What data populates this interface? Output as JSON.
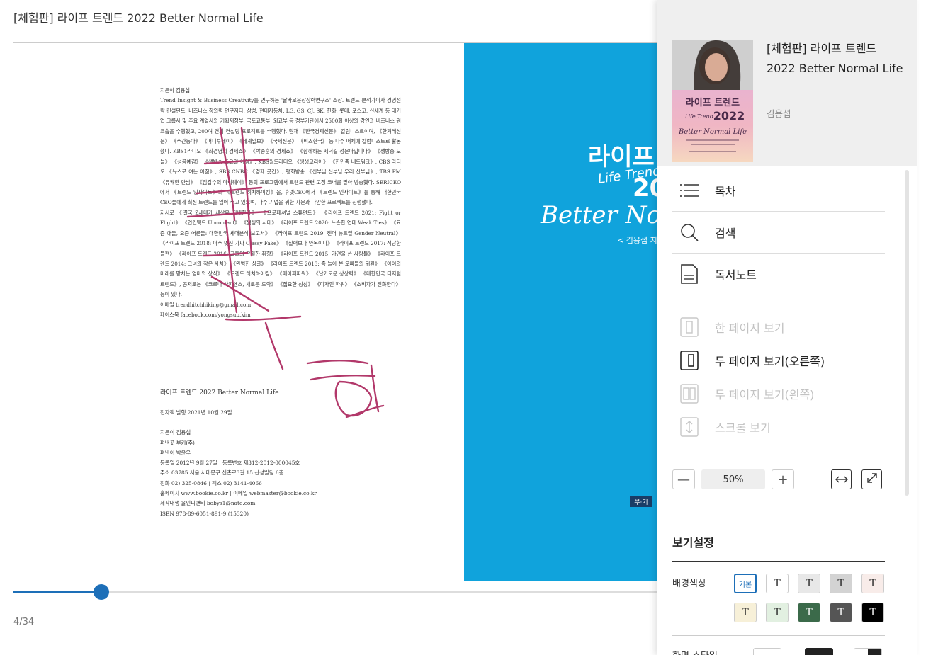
{
  "viewer": {
    "book_title": "[체험판] 라이프 트렌드 2022 Better Normal Life",
    "page_counter": "4/34",
    "progress": 0.137
  },
  "left_page": {
    "author_bio": [
      "지은이 김용섭",
      "Trend Insight & Business Creativity를 연구하는 '날카로운상상력연구소' 소장. 트렌드 분석가이자 경영전략 컨설턴트, 비즈니스 창의력 연구자다. 삼성, 현대자동차, LG, GS, CJ, SK, 한화, 롯데, 포스코, 신세계 등 대기업 그룹사 및 주요 계열사와 기획재정부, 국토교통부, 외교부 등 정부기관에서 2500회 이상의 강연과 비즈니스 워크숍을 수행했고, 200여 건의 컨설팅 프로젝트를 수행했다. 현재 《한국경제신문》 칼럼니스트이며, 《한겨레신문》 《주간동아》 《머니투데이》 《세계일보》 《국제신문》 《비즈한국》 등 다수 매체에 칼럼니스트로 활동했다. KBS1라디오 《최경영의 경제쇼》 《박종훈의 경제쇼》 《함께하는 저녁길 정은아입니다》 《생방송 오늘》 《성공예감》 《생방송 토요일 아침》, KBS월드라디오 《생생코리아》 《한민족 네트워크》, CBS 라디오 《뉴스로 여는 아침》, SBS CNBC 《경제 곳간》, 평화방송 《신부님 신부님 우리 신부님》, TBS FM 《유쾌한 만남》 《김갑수의 마이웨이》 등의 프로그램에서 트렌드 관련 고정 코너를 맡아 방송했다. SERICEO에서 《트렌드 인사이트》와 《트렌드 히치하이킹》을, 휴넷CEO에서 《트렌드 인사이트》를 통해 대한민국 CEO들에게 최신 트렌드를 읽어 주고 있으며, 다수 기업을 위한 자문과 다양한 프로젝트를 진행했다.",
      "저서로 《결국 Z세대가 세상을 지배한다》 《프로페셔널 스튜던트》 《라이프 트렌드 2021: Fight or Flight》 《언컨택트 Uncontact》 《썸씽의 시대》 《라이프 트렌드 2020: 느슨한 연대 Weak Ties》 《요즘 애들, 요즘 어른들: 대한민국 세대분석 보고서》 《라이프 트렌드 2019: 젠더 뉴트럴 Gender Neutral》 《라이프 트렌드 2018: 아주 멋진 가짜 Classy Fake》 《실력보다 안목이다》 《라이프 트렌드 2017: 적당한 불편》 《라이프 트렌드 2016: 그들의 은밀한 취향》 《라이프 트렌드 2015: 가면을 쓴 사람들》 《라이프 트렌드 2014: 그녀의 작은 사치》 《완벽한 싱글》 《라이프 트렌드 2013: 좀 놀아 본 오빠들의 귀환》 《아이의 미래를 망치는 엄마의 상식》 《트렌드 히치하이킹》 《페이퍼파워》 《날카로운 상상력》 《대한민국 디지털 트렌드》, 공저로는 《코로나 사피엔스, 새로운 도약》 《집요한 상상》 《디자인 파워》 《소비자가 진화한다》 등이 있다."
    ],
    "email": "이메일 trendhitchhiking@gmail.com",
    "facebook": "페이스북 facebook.com/yongsub.kim",
    "colophon": {
      "title": "라이프 트렌드 2022 Better Normal Life",
      "ebook_date": "전자책 발행 2021년 10월 29일",
      "author": "지은이 김용섭",
      "publisher_co": "펴낸곳 부키(주)",
      "publisher": "펴낸이 박윤우",
      "registration": "등록일 2012년 9월 27일 | 등록번호 제312-2012-000045호",
      "address": "주소 03785 서울 서대문구 신촌로3길 15 산성빌딩 6층",
      "phone": "전화 02) 325-0846 | 팩스 02) 3141-4066",
      "homepage": "홈페이지 www.bookie.co.kr | 이메일 webmaster@bookie.co.kr",
      "production": "제작대행 올인피앤비 bobys1@nate.com",
      "isbn": "ISBN 978-89-6051-891-9 (15320)"
    }
  },
  "right_page": {
    "cover_title_ko": "라이프 트",
    "cover_life_trend": "Life Trend",
    "cover_year": "20",
    "cover_subtitle": "Better Norm",
    "cover_author_line": "< 김용섭 지음",
    "publisher_badge": "부·키",
    "color": "#10a3dc"
  },
  "panel": {
    "title": "[체험판] 라이프 트렌드 2022 Better Normal Life",
    "author": "김용섭",
    "thumb_title": "라이프 트렌드",
    "thumb_life_trend": "Life Trend",
    "thumb_year": "2022",
    "thumb_subtitle": "Better Normal Life",
    "menu": [
      {
        "label": "목차",
        "icon": "list-icon"
      },
      {
        "label": "검색",
        "icon": "search-icon"
      },
      {
        "label": "독서노트",
        "icon": "note-icon"
      }
    ],
    "view_modes": [
      {
        "label": "한 페이지 보기",
        "icon": "single-page-icon",
        "enabled": false
      },
      {
        "label": "두 페이지 보기(오른쪽)",
        "icon": "two-page-right-icon",
        "enabled": true
      },
      {
        "label": "두 페이지 보기(왼쪽)",
        "icon": "two-page-left-icon",
        "enabled": false
      },
      {
        "label": "스크롤 보기",
        "icon": "scroll-view-icon",
        "enabled": false
      }
    ],
    "zoom": {
      "minus": "—",
      "value": "50%",
      "plus": "+"
    },
    "settings_title": "보기설정",
    "bg_color_label": "배경색상",
    "swatches": [
      {
        "label": "기본",
        "bg": "#ffffff",
        "fg": "#1d6fb8",
        "selected": true
      },
      {
        "label": "T",
        "bg": "#ffffff",
        "fg": "#222222"
      },
      {
        "label": "T",
        "bg": "#e8e8e8",
        "fg": "#222222"
      },
      {
        "label": "T",
        "bg": "#d3d3d3",
        "fg": "#222222"
      },
      {
        "label": "T",
        "bg": "#f8ece9",
        "fg": "#222222"
      },
      {
        "label": "T",
        "bg": "#f7f0d8",
        "fg": "#222222"
      },
      {
        "label": "T",
        "bg": "#e2f0e1",
        "fg": "#222222"
      },
      {
        "label": "T",
        "bg": "#3b6a4a",
        "fg": "#ffffff"
      },
      {
        "label": "T",
        "bg": "#555555",
        "fg": "#ffffff"
      },
      {
        "label": "T",
        "bg": "#000000",
        "fg": "#ffffff"
      }
    ],
    "screen_style_label": "화면 스타일"
  }
}
